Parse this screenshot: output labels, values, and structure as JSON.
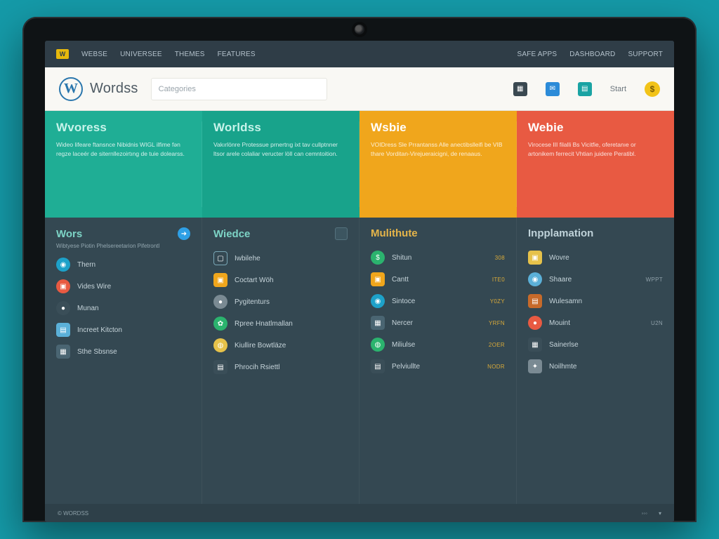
{
  "topbar": {
    "badge": "W",
    "left": [
      "WEBSE",
      "UNIVERSEE",
      "THEMES",
      "FEATURES"
    ],
    "right": [
      "SAFE APPS",
      "DASHBOARD",
      "SUPPORT"
    ]
  },
  "header": {
    "logo_text": "Wordss",
    "search_label": "Categories",
    "icons": [
      {
        "id": "apps",
        "variant": "dark"
      },
      {
        "id": "mail",
        "variant": "blue"
      },
      {
        "id": "stats",
        "variant": "teal"
      }
    ],
    "pill": "Start",
    "coin": "$"
  },
  "hero": [
    {
      "title": "Wvoress",
      "body": "Wideo lifeare ftansnce Nibidnis WIGL ilfime fən regze laceér de siternllezoirtıng de tuie dolearss."
    },
    {
      "title": "Worldss",
      "body": "Vakırlönre Protessue prnertrıg ixt tav cullptnner ltsor arele colaliar veructer löll can cemntoition."
    },
    {
      "title": "Wsbie",
      "body": "VOIDress Sle Prrantanss Alle anectibslleifi be VIB thare Vorditan-Virejueraicigni, de renaaus."
    },
    {
      "title": "Webie",
      "body": "Virocese III filalli Bs Vicitfie, oferetanıe or artonikem ferrecit Vhtian juidere Peratibl."
    }
  ],
  "columns": [
    {
      "title": "Wors",
      "title_style": "teal",
      "head_icon": "azure",
      "sub": "Wibtyese Piotin Phelsereetarion Pifetrontl",
      "items": [
        {
          "icon": "c1",
          "label": "Thern",
          "meta": ""
        },
        {
          "icon": "c2",
          "label": "Vides Wire",
          "meta": ""
        },
        {
          "icon": "c4",
          "label": "Munan",
          "meta": ""
        },
        {
          "icon": "c9",
          "shape": "sq",
          "label": "Increet Kitcton",
          "meta": ""
        },
        {
          "icon": "c6",
          "shape": "sq",
          "label": "Sthe Sbsnse",
          "meta": ""
        }
      ]
    },
    {
      "title": "Wiedce",
      "title_style": "teal",
      "head_icon": "green_sq",
      "sub": "",
      "items": [
        {
          "icon": "outline",
          "label": "Iwbilehe",
          "meta": ""
        },
        {
          "icon": "c5",
          "shape": "sq",
          "label": "Coctart Wöh",
          "meta": ""
        },
        {
          "icon": "c8",
          "label": "Pygitenturs",
          "meta": ""
        },
        {
          "icon": "c3",
          "label": "Rpree Hnatlmallan",
          "meta": ""
        },
        {
          "icon": "c7",
          "label": "Kiullire Bowtläze",
          "meta": ""
        },
        {
          "icon": "c4",
          "shape": "sq",
          "label": "Phrocih Rsiettl",
          "meta": ""
        }
      ]
    },
    {
      "title": "Mulithute",
      "title_style": "gold",
      "head_icon": "",
      "sub": "",
      "items": [
        {
          "icon": "c3",
          "label": "Shitun",
          "meta": "308",
          "meta_style": "gold"
        },
        {
          "icon": "c5",
          "shape": "sq",
          "label": "Cantt",
          "meta": "ITE0",
          "meta_style": "gold"
        },
        {
          "icon": "c1",
          "label": "Sintoce",
          "meta": "Y0ZY",
          "meta_style": "gold"
        },
        {
          "icon": "c6",
          "shape": "sq",
          "label": "Nercer",
          "meta": "YRFN",
          "meta_style": "gold"
        },
        {
          "icon": "c3",
          "label": "Miliulse",
          "meta": "2OER",
          "meta_style": "gold"
        },
        {
          "icon": "c4",
          "shape": "sq",
          "label": "Pelviullte",
          "meta": "NODR",
          "meta_style": "gold"
        }
      ]
    },
    {
      "title": "Inpplamation",
      "title_style": "pale",
      "head_icon": "",
      "sub": "",
      "items": [
        {
          "icon": "c7",
          "shape": "sq",
          "label": "Wovre",
          "meta": ""
        },
        {
          "icon": "c9",
          "label": "Shaare",
          "meta": "WPPT"
        },
        {
          "icon": "c10",
          "shape": "sq",
          "label": "Wulesamn",
          "meta": ""
        },
        {
          "icon": "c2",
          "label": "Mouint",
          "meta": "U2N"
        },
        {
          "icon": "c4",
          "shape": "sq",
          "label": "Sainerlse",
          "meta": ""
        },
        {
          "icon": "c8",
          "shape": "sq",
          "label": "Noilhmte",
          "meta": ""
        }
      ]
    }
  ],
  "bottom": {
    "left": "© WORDSS",
    "items": [
      "◦◦◦",
      "▾"
    ]
  }
}
